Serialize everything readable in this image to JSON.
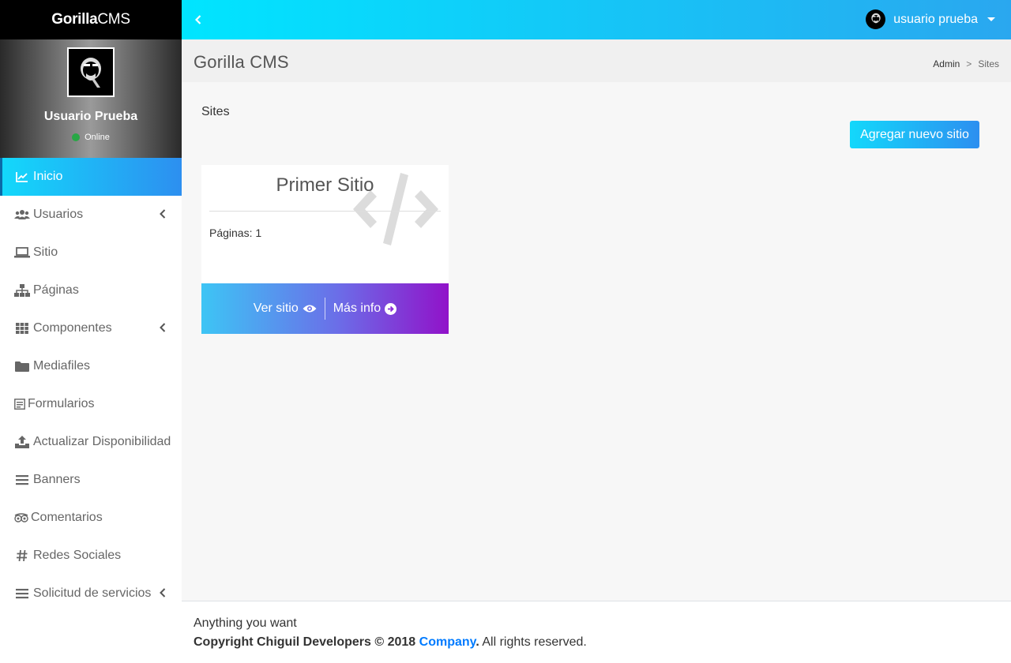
{
  "brand": {
    "bold": "Gorilla",
    "light": "CMS"
  },
  "user_panel": {
    "name": "Usuario Prueba",
    "status": "Online",
    "status_color": "#28a745"
  },
  "sidebar": {
    "items": [
      {
        "label": "Inicio",
        "icon": "chart-line-icon",
        "active": true
      },
      {
        "label": "Usuarios",
        "icon": "users-icon",
        "has_submenu": true
      },
      {
        "label": "Sitio",
        "icon": "laptop-icon"
      },
      {
        "label": "Páginas",
        "icon": "sitemap-icon"
      },
      {
        "label": "Componentes",
        "icon": "grid-icon",
        "has_submenu": true
      },
      {
        "label": "Mediafiles",
        "icon": "folder-icon"
      },
      {
        "label": "Formularios",
        "icon": "form-icon"
      },
      {
        "label": "Actualizar Disponibilidad",
        "icon": "upload-icon"
      },
      {
        "label": "Banners",
        "icon": "bars-icon"
      },
      {
        "label": "Comentarios",
        "icon": "tripadvisor-icon"
      },
      {
        "label": "Redes Sociales",
        "icon": "hashtag-icon"
      },
      {
        "label": "Solicitud de servicios",
        "icon": "bars-icon",
        "has_submenu": true
      }
    ]
  },
  "topbar": {
    "user_name": "usuario prueba"
  },
  "header": {
    "title": "Gorilla CMS",
    "breadcrumb": {
      "root": "Admin",
      "separator": ">",
      "current": "Sites"
    }
  },
  "main": {
    "section_title": "Sites",
    "add_button": "Agregar nuevo sitio",
    "site_card": {
      "title": "Primer Sitio",
      "pages": "Páginas: 1",
      "view_button": "Ver sitio",
      "info_button": "Más info"
    }
  },
  "footer": {
    "line1": "Anything you want",
    "copyright": "Copyright Chiguil Developers © 2018",
    "company": "Company",
    "period": ".",
    "rights": "All rights reserved."
  },
  "colors": {
    "accent_start": "#13d8fb",
    "accent_end": "#2d8ff0",
    "card_gradient_end": "#9112c9",
    "link": "#007bff"
  }
}
